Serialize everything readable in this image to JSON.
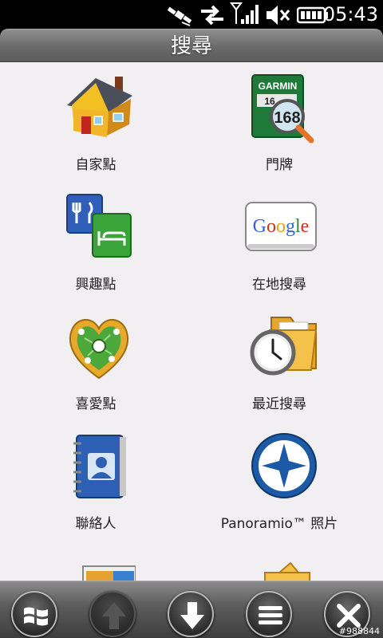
{
  "status": {
    "time": "05:43",
    "icons": [
      "gps-satellite-icon",
      "data-transfer-icon",
      "signal-strength-icon",
      "volume-muted-icon",
      "battery-icon"
    ]
  },
  "title": "搜尋",
  "menu": {
    "items": [
      {
        "label": "自家點",
        "icon": "home-icon"
      },
      {
        "label": "門牌",
        "icon": "garmin-address-icon"
      },
      {
        "label": "興趣點",
        "icon": "points-of-interest-icon"
      },
      {
        "label": "在地搜尋",
        "icon": "google-icon",
        "brand": "Google"
      },
      {
        "label": "喜愛點",
        "icon": "favorites-heart-icon"
      },
      {
        "label": "最近搜尋",
        "icon": "recent-search-clock-icon"
      },
      {
        "label": "聯絡人",
        "icon": "contacts-book-icon"
      },
      {
        "label": "Panoramio™ 照片",
        "icon": "panoramio-compass-icon"
      }
    ],
    "garmin_sign": {
      "brand": "GARMIN",
      "number": "168",
      "small": "16"
    }
  },
  "toolbar": {
    "buttons": [
      {
        "name": "windows-start-icon",
        "enabled": true
      },
      {
        "name": "scroll-up-icon",
        "enabled": false
      },
      {
        "name": "scroll-down-icon",
        "enabled": true
      },
      {
        "name": "menu-icon",
        "enabled": true
      },
      {
        "name": "close-icon",
        "enabled": true
      }
    ],
    "watermark": "#988844"
  },
  "colors": {
    "content_bg": "#f1eff1",
    "panoramio_blue": "#1c5aa6",
    "google_blue": "#3366cc",
    "google_red": "#d62d20",
    "google_yellow": "#e6a40b",
    "google_green": "#2a8f32"
  }
}
